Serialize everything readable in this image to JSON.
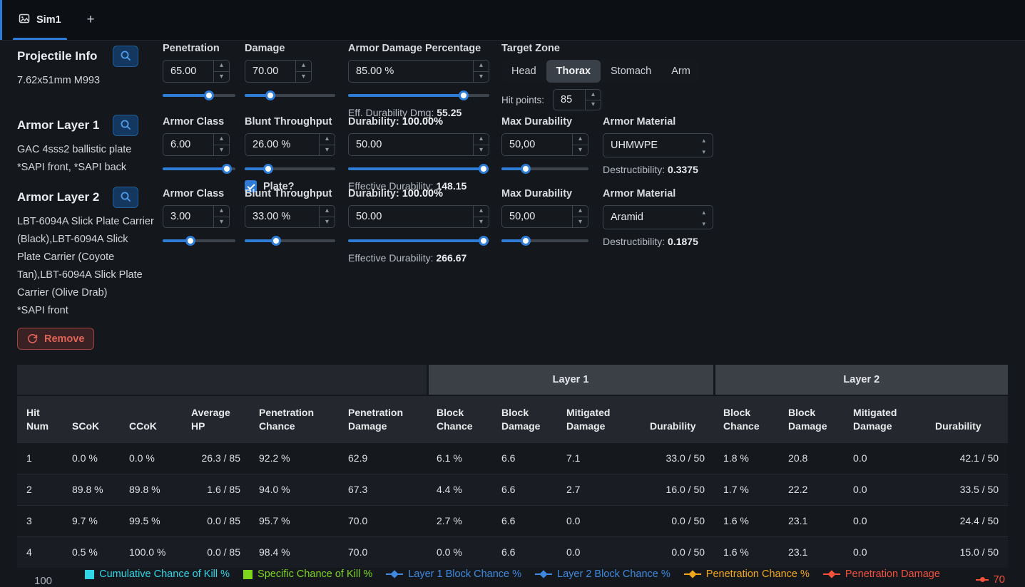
{
  "tabs": {
    "active": "Sim1",
    "add": "+"
  },
  "colors": {
    "accent": "#2e7cd6"
  },
  "sidebar": {
    "projectile": {
      "title": "Projectile Info",
      "name": "7.62x51mm M993"
    },
    "layer1": {
      "title": "Armor Layer 1",
      "name": "GAC 4sss2 ballistic plate",
      "note": "*SAPI front, *SAPI back"
    },
    "layer2": {
      "title": "Armor Layer 2",
      "name": "LBT-6094A Slick Plate Carrier (Black),LBT-6094A Slick Plate Carrier (Coyote Tan),LBT-6094A Slick Plate Carrier (Olive Drab)",
      "note": "*SAPI front"
    },
    "remove_label": "Remove"
  },
  "projectile": {
    "penetration": {
      "label": "Penetration",
      "value": "65.00",
      "slider_pct": 64
    },
    "damage": {
      "label": "Damage",
      "value": "70.00",
      "slider_pct": 28
    },
    "armor_damage": {
      "label": "Armor Damage Percentage",
      "value": "85.00 %",
      "slider_pct": 82,
      "eff_label": "Eff. Durability Dmg:",
      "eff_value": "55.25"
    },
    "target_zone": {
      "label": "Target Zone",
      "zones": [
        "Head",
        "Thorax",
        "Stomach",
        "Arm"
      ],
      "selected": "Thorax",
      "hp_label": "Hit points:",
      "hp_value": "85"
    }
  },
  "layers": [
    {
      "armor_class": {
        "label": "Armor Class",
        "value": "6.00",
        "slider_pct": 88
      },
      "blunt": {
        "label": "Blunt Throughput",
        "value": "26.00 %",
        "slider_pct": 26
      },
      "plate_label": "Plate?",
      "durability": {
        "label": "Durability:",
        "pct": "100.00%",
        "value": "50.00",
        "slider_pct": 96,
        "eff_label": "Effective Durability:",
        "eff_value": "148.15"
      },
      "max_durability": {
        "label": "Max Durability",
        "value": "50,00",
        "slider_pct": 28
      },
      "material": {
        "label": "Armor Material",
        "value": "UHMWPE",
        "destr_label": "Destructibility:",
        "destr_value": "0.3375"
      }
    },
    {
      "armor_class": {
        "label": "Armor Class",
        "value": "3.00",
        "slider_pct": 38
      },
      "blunt": {
        "label": "Blunt Throughput",
        "value": "33.00 %",
        "slider_pct": 35
      },
      "durability": {
        "label": "Durability:",
        "pct": "100.00%",
        "value": "50.00",
        "slider_pct": 96,
        "eff_label": "Effective Durability:",
        "eff_value": "266.67"
      },
      "max_durability": {
        "label": "Max Durability",
        "value": "50,00",
        "slider_pct": 28
      },
      "material": {
        "label": "Armor Material",
        "value": "Aramid",
        "destr_label": "Destructibility:",
        "destr_value": "0.1875"
      }
    }
  ],
  "table": {
    "group_layer1": "Layer 1",
    "group_layer2": "Layer 2",
    "columns": [
      "Hit\nNum",
      "SCoK",
      "CCoK",
      "Average\nHP",
      "Penetration\nChance",
      "Penetration\nDamage",
      "Block\nChance",
      "Block\nDamage",
      "Mitigated\nDamage",
      "Durability",
      "Block\nChance",
      "Block\nDamage",
      "Mitigated\nDamage",
      "Durability"
    ],
    "rows": [
      [
        "1",
        "0.0 %",
        "0.0 %",
        "26.3 / 85",
        "92.2 %",
        "62.9",
        "6.1 %",
        "6.6",
        "7.1",
        "33.0 / 50",
        "1.8 %",
        "20.8",
        "0.0",
        "42.1 / 50"
      ],
      [
        "2",
        "89.8 %",
        "89.8 %",
        "1.6 / 85",
        "94.0 %",
        "67.3",
        "4.4 %",
        "6.6",
        "2.7",
        "16.0 / 50",
        "1.7 %",
        "22.2",
        "0.0",
        "33.5 / 50"
      ],
      [
        "3",
        "9.7 %",
        "99.5 %",
        "0.0 / 85",
        "95.7 %",
        "70.0",
        "2.7 %",
        "6.6",
        "0.0",
        "0.0 / 50",
        "1.6 %",
        "23.1",
        "0.0",
        "24.4 / 50"
      ],
      [
        "4",
        "0.5 %",
        "100.0 %",
        "0.0 / 85",
        "98.4 %",
        "70.0",
        "0.0 %",
        "6.6",
        "0.0",
        "0.0 / 50",
        "1.6 %",
        "23.1",
        "0.0",
        "15.0 / 50"
      ]
    ]
  },
  "legend": {
    "items": [
      {
        "label": "Cumulative Chance of Kill %",
        "color": "#2fd6e8",
        "marker": "square"
      },
      {
        "label": "Specific Chance of Kill %",
        "color": "#7fd41c",
        "marker": "square"
      },
      {
        "label": "Layer 1 Block Chance %",
        "color": "#3e8ae0",
        "marker": "diamond"
      },
      {
        "label": "Layer 2 Block Chance %",
        "color": "#3e8ae0",
        "marker": "diamond"
      },
      {
        "label": "Penetration Chance %",
        "color": "#f2a71b",
        "marker": "diamond"
      },
      {
        "label": "Penetration Damage",
        "color": "#f4503c",
        "marker": "diamond"
      }
    ]
  },
  "chart": {
    "axis_tick": "100",
    "point_label": "70"
  }
}
